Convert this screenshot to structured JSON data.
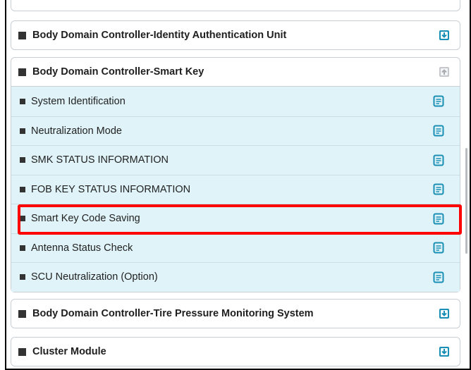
{
  "sections": {
    "identity": {
      "title": "Body Domain Controller-Identity Authentication Unit",
      "toggle_icon": "expand-down-icon"
    },
    "smart_key": {
      "title": "Body Domain Controller-Smart Key",
      "toggle_icon": "collapse-up-icon",
      "items": [
        {
          "label": "System Identification",
          "icon": "document-icon"
        },
        {
          "label": "Neutralization Mode",
          "icon": "document-icon"
        },
        {
          "label": "SMK STATUS INFORMATION",
          "icon": "document-icon"
        },
        {
          "label": "FOB KEY STATUS INFORMATION",
          "icon": "document-icon"
        },
        {
          "label": "Smart Key Code Saving",
          "icon": "document-icon",
          "highlighted": true
        },
        {
          "label": "Antenna Status Check",
          "icon": "document-icon"
        },
        {
          "label": "SCU Neutralization (Option)",
          "icon": "document-icon"
        }
      ]
    },
    "tpms": {
      "title": "Body Domain Controller-Tire Pressure Monitoring System",
      "toggle_icon": "expand-down-icon"
    },
    "cluster": {
      "title": "Cluster Module",
      "toggle_icon": "expand-down-icon"
    }
  },
  "colors": {
    "item_bg": "#dff3f8",
    "accent_icon": "#1a8fb5",
    "highlight": "#ff0000"
  }
}
